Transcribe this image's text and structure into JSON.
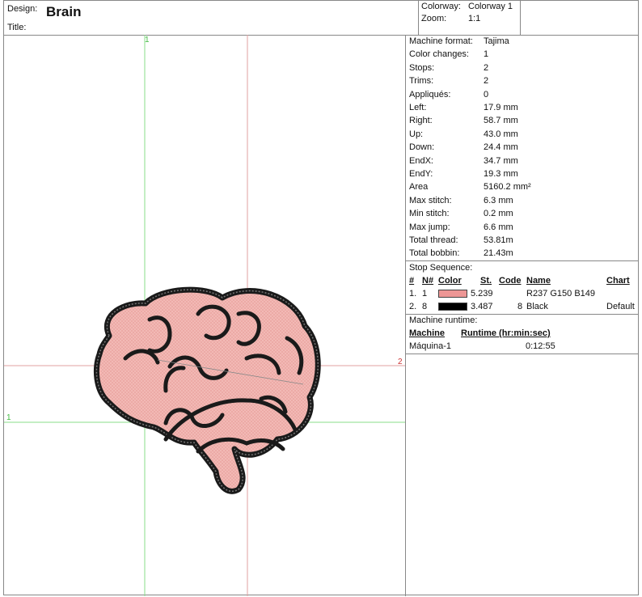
{
  "header": {
    "design_label": "Design:",
    "design_value": "Brain",
    "title_label": "Title:",
    "colorway_label": "Colorway:",
    "colorway_value": "Colorway 1",
    "zoom_label": "Zoom:",
    "zoom_value": "1:1"
  },
  "canvas": {
    "marker_top": "1",
    "marker_left": "1",
    "marker_right": "2",
    "guide_green": "#88dd88",
    "guide_red": "#e0a0a0",
    "fill_color": "#F0B4B0",
    "outline_color": "#1a1a1a"
  },
  "stats": [
    {
      "label": "Machine format:",
      "value": "Tajima"
    },
    {
      "label": "Color changes:",
      "value": "1"
    },
    {
      "label": "Stops:",
      "value": "2"
    },
    {
      "label": "Trims:",
      "value": "2"
    },
    {
      "label": "Appliqués:",
      "value": "0"
    },
    {
      "label": "Left:",
      "value": "17.9 mm"
    },
    {
      "label": "Right:",
      "value": "58.7 mm"
    },
    {
      "label": "Up:",
      "value": "43.0 mm"
    },
    {
      "label": "Down:",
      "value": "24.4 mm"
    },
    {
      "label": "EndX:",
      "value": "34.7 mm"
    },
    {
      "label": "EndY:",
      "value": "19.3 mm"
    },
    {
      "label": "Area",
      "value": "5160.2 mm²"
    },
    {
      "label": "Max stitch:",
      "value": "6.3 mm"
    },
    {
      "label": "Min stitch:",
      "value": "0.2 mm"
    },
    {
      "label": "Max jump:",
      "value": "6.6 mm"
    },
    {
      "label": "Total thread:",
      "value": "53.81m"
    },
    {
      "label": "Total bobbin:",
      "value": "21.43m"
    }
  ],
  "stop_sequence": {
    "title": "Stop Sequence:",
    "headers": {
      "num": "#",
      "n": "N#",
      "color": "Color",
      "st": "St.",
      "code": "Code",
      "name": "Name",
      "chart": "Chart"
    },
    "rows": [
      {
        "num": "1.",
        "n": "1",
        "swatch": "#ED9695",
        "st": "5.239",
        "code": "",
        "name": "R237 G150 B149",
        "chart": ""
      },
      {
        "num": "2.",
        "n": "8",
        "swatch": "#000000",
        "st": "3.487",
        "code": "8",
        "name": "Black",
        "chart": "Default"
      }
    ]
  },
  "runtime": {
    "title": "Machine runtime:",
    "headers": {
      "machine": "Machine",
      "runtime": "Runtime (hr:min:sec)"
    },
    "rows": [
      {
        "machine": "Máquina-1",
        "runtime": "0:12:55"
      }
    ]
  }
}
